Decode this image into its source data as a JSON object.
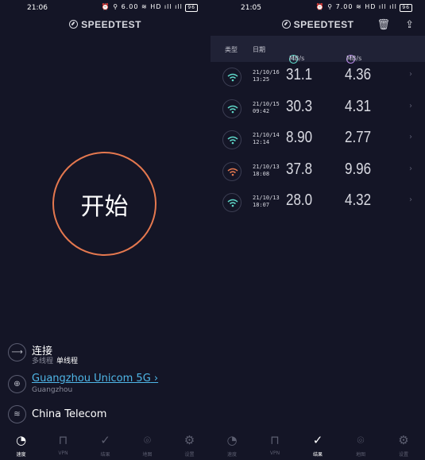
{
  "left": {
    "status": {
      "time": "21:06",
      "icons": "⏰ ⚲ 6.00 ≋ HD ıll ıll",
      "battery": "96"
    },
    "brand": "SPEEDTEST",
    "start_label": "开始",
    "connections": {
      "label": "连接",
      "multi": "多线程",
      "single": "单线程"
    },
    "server": {
      "name": "Guangzhou Unicom 5G",
      "city": "Guangzhou"
    },
    "provider": "China Telecom",
    "nav": [
      {
        "label": "速度",
        "icon": "gauge-icon",
        "active": true
      },
      {
        "label": "VPN",
        "icon": "lock-icon",
        "active": false
      },
      {
        "label": "结果",
        "icon": "check-icon",
        "active": false
      },
      {
        "label": "地图",
        "icon": "map-pin-icon",
        "active": false
      },
      {
        "label": "设置",
        "icon": "gear-icon",
        "active": false
      }
    ]
  },
  "right": {
    "status": {
      "time": "21:05",
      "icons": "⏰ ⚲ 7.00 ≋ HD ıll ıll",
      "battery": "96"
    },
    "brand": "SPEEDTEST",
    "header": {
      "type": "类型",
      "date": "日期",
      "download_unit": "MB/s",
      "upload_unit": "MB/s"
    },
    "results": [
      {
        "date": "21/10/16",
        "time": "13:25",
        "download": "31.1",
        "upload": "4.36",
        "color": "#5ed7c8"
      },
      {
        "date": "21/10/15",
        "time": "09:42",
        "download": "30.3",
        "upload": "4.31",
        "color": "#5ed7c8"
      },
      {
        "date": "21/10/14",
        "time": "12:14",
        "download": "8.90",
        "upload": "2.77",
        "color": "#5ed7c8"
      },
      {
        "date": "21/10/13",
        "time": "18:08",
        "download": "37.8",
        "upload": "9.96",
        "color": "#e5784f"
      },
      {
        "date": "21/10/13",
        "time": "18:07",
        "download": "28.0",
        "upload": "4.32",
        "color": "#5ed7c8"
      }
    ],
    "nav": [
      {
        "label": "速度",
        "icon": "gauge-icon",
        "active": false
      },
      {
        "label": "VPN",
        "icon": "lock-icon",
        "active": false
      },
      {
        "label": "结果",
        "icon": "check-icon",
        "active": true
      },
      {
        "label": "地图",
        "icon": "map-pin-icon",
        "active": false
      },
      {
        "label": "设置",
        "icon": "gear-icon",
        "active": false
      }
    ]
  },
  "colors": {
    "background": "#141526",
    "accent": "#e5784f",
    "download": "#5ed7c8",
    "upload": "#b88ae8",
    "link": "#4fb7e8"
  }
}
